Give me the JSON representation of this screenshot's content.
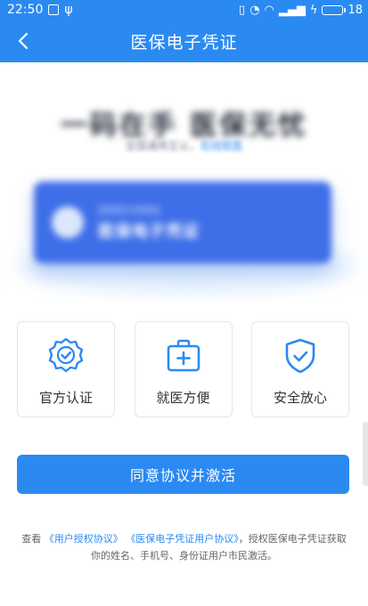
{
  "status_bar": {
    "time": "22:50",
    "battery_level": "18",
    "icons": [
      "image-icon",
      "usb-icon",
      "vibrate-icon",
      "alarm-icon",
      "wifi-icon",
      "signal-icon",
      "charging-icon",
      "battery-icon"
    ]
  },
  "header": {
    "title": "医保电子凭证",
    "back_icon": "back-chevron-icon"
  },
  "hero": {
    "slogan": "一码在手  医保无忧",
    "sub_slogan_prefix": "全国通用互认，",
    "sub_slogan_highlight": "在线就医",
    "card_small": "国家医疗保障局",
    "card_big": "医保电子凭证"
  },
  "features": [
    {
      "label": "官方认证",
      "icon": "certified-badge-icon"
    },
    {
      "label": "就医方便",
      "icon": "medical-kit-icon"
    },
    {
      "label": "安全放心",
      "icon": "shield-check-icon"
    }
  ],
  "activate_button": {
    "label": "同意协议并激活"
  },
  "agreement": {
    "prefix": "查看",
    "link1": "《用户授权协议》",
    "link2": "《医保电子凭证用户协议》",
    "suffix": "，授权医保电子凭证获取你的姓名、手机号、身份证用户市民激活。"
  },
  "colors": {
    "primary": "#2a8af2",
    "card": "#3e6ee8",
    "text": "#333333",
    "muted": "#666666"
  }
}
